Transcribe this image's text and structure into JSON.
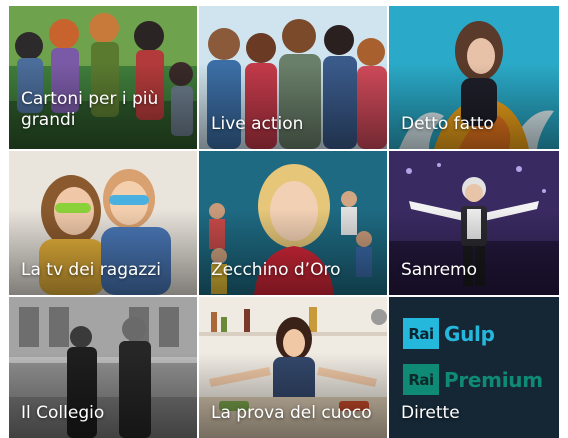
{
  "tiles": [
    {
      "label": "Cartoni per i più grandi"
    },
    {
      "label": "Live action"
    },
    {
      "label": "Detto fatto"
    },
    {
      "label": "La tv dei ragazzi"
    },
    {
      "label": "Zecchino d’Oro"
    },
    {
      "label": "Sanremo"
    },
    {
      "label": "Il Collegio"
    },
    {
      "label": "La prova del cuoco"
    },
    {
      "label": "Dirette"
    }
  ],
  "logos": {
    "gulp": {
      "box": "Rai",
      "word": "Gulp"
    },
    "premium": {
      "box": "Rai",
      "word": "Premium"
    }
  },
  "colors": {
    "dirette_bg": "#152734",
    "gulp": "#25b8dd",
    "premium": "#0f8a74"
  }
}
